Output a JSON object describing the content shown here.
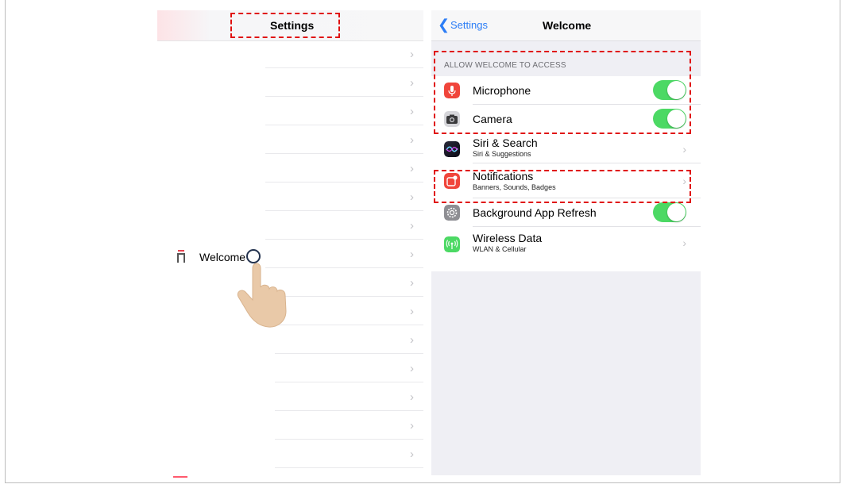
{
  "left_panel": {
    "title": "Settings",
    "selected_app": "Welcome",
    "chevron": "›",
    "app_icon": "welcome-app-icon",
    "pointer": "hand-tap-icon"
  },
  "right_panel": {
    "back_label": "Settings",
    "back_icon": "chevron-left-icon",
    "title": "Welcome",
    "section_header": "ALLOW WELCOME TO ACCESS",
    "rows": [
      {
        "icon": "microphone-icon",
        "label": "Microphone",
        "toggle": true
      },
      {
        "icon": "camera-icon",
        "label": "Camera",
        "toggle": true
      },
      {
        "icon": "siri-icon",
        "label": "Siri & Search",
        "sub": "Siri & Suggestions"
      },
      {
        "icon": "notifications-icon",
        "label": "Notifications",
        "sub": "Banners, Sounds, Badges"
      },
      {
        "icon": "gear-icon",
        "label": "Background App Refresh",
        "toggle": true
      },
      {
        "icon": "wireless-data-icon",
        "label": "Wireless Data",
        "sub": "WLAN & Cellular"
      }
    ]
  },
  "colors": {
    "accent_blue": "#2c7df6",
    "toggle_on": "#4cd964",
    "highlight": "#e01010"
  }
}
